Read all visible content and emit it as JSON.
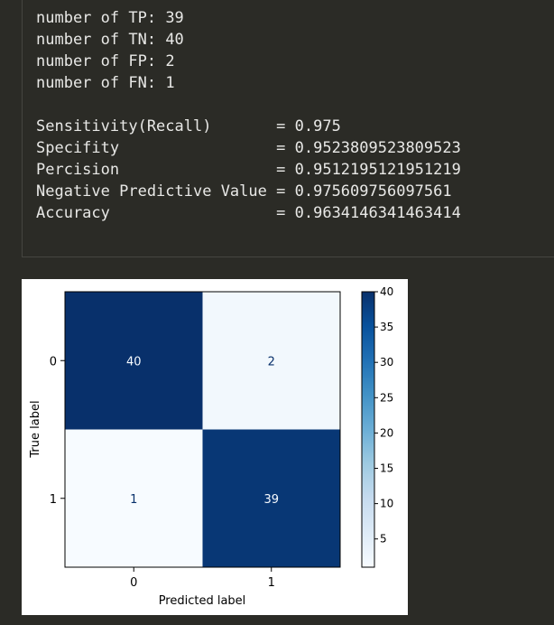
{
  "console": {
    "counts": [
      {
        "label": "number of TP:",
        "value": "39"
      },
      {
        "label": "number of TN:",
        "value": "40"
      },
      {
        "label": "number of FP:",
        "value": "2"
      },
      {
        "label": "number of FN:",
        "value": "1"
      }
    ],
    "metrics": [
      {
        "label": "Sensitivity(Recall)",
        "value": "0.975"
      },
      {
        "label": "Specifity",
        "value": "0.9523809523809523"
      },
      {
        "label": "Percision",
        "value": "0.9512195121951219"
      },
      {
        "label": "Negative Predictive Value",
        "value": "0.975609756097561"
      },
      {
        "label": "Accuracy",
        "value": "0.9634146341463414"
      }
    ],
    "separator": "="
  },
  "chart_data": {
    "type": "heatmap",
    "xlabel": "Predicted label",
    "ylabel": "True label",
    "x_categories": [
      "0",
      "1"
    ],
    "y_categories": [
      "0",
      "1"
    ],
    "values": [
      [
        40,
        2
      ],
      [
        1,
        39
      ]
    ],
    "colormap": "Blues",
    "vmin": 1,
    "vmax": 40,
    "colorbar_ticks": [
      5,
      10,
      15,
      20,
      25,
      30,
      35,
      40
    ],
    "colors": {
      "dark": "#08306b",
      "light": "#f7fbff",
      "text_on_dark": "#f7fbff",
      "text_on_light": "#08306b"
    }
  }
}
